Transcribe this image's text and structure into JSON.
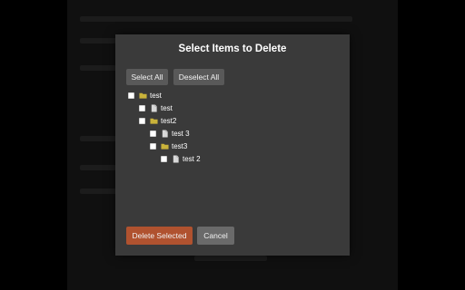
{
  "dialog": {
    "title": "Select Items to Delete",
    "select_all_label": "Select All",
    "deselect_all_label": "Deselect All",
    "delete_selected_label": "Delete Selected",
    "cancel_label": "Cancel"
  },
  "tree": [
    {
      "label": "test",
      "type": "folder",
      "depth": 0,
      "checked": false
    },
    {
      "label": "test",
      "type": "file",
      "depth": 1,
      "checked": false
    },
    {
      "label": "test2",
      "type": "folder",
      "depth": 1,
      "checked": false
    },
    {
      "label": "test 3",
      "type": "file",
      "depth": 2,
      "checked": false
    },
    {
      "label": "test3",
      "type": "folder",
      "depth": 2,
      "checked": false
    },
    {
      "label": "test 2",
      "type": "file",
      "depth": 3,
      "checked": false
    }
  ],
  "colors": {
    "modal_bg": "#3a3a3a",
    "button_bg": "#595959",
    "delete_button_bg": "#b0522f",
    "cancel_button_bg": "#6a6a6a",
    "folder_icon": "#c9b23a",
    "file_icon": "#d8d8d8"
  },
  "icons": {
    "folder": "folder-icon",
    "file": "file-icon"
  }
}
